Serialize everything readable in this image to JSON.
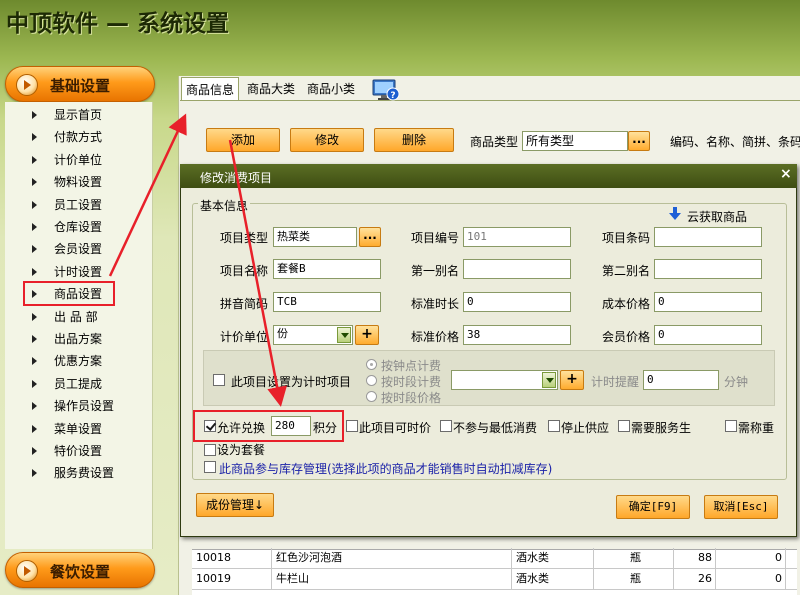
{
  "app": {
    "title": "中顶软件 — 系统设置"
  },
  "sidebar": {
    "section_top": "基础设置",
    "section_bottom": "餐饮设置",
    "items": [
      "显示首页",
      "付款方式",
      "计价单位",
      "物料设置",
      "员工设置",
      "仓库设置",
      "会员设置",
      "计时设置",
      "商品设置",
      "出 品 部",
      "出品方案",
      "优惠方案",
      "员工提成",
      "操作员设置",
      "菜单设置",
      "特价设置",
      "服务费设置"
    ]
  },
  "tabs": [
    "商品信息",
    "商品大类",
    "商品小类"
  ],
  "toolbar": {
    "add": "添加",
    "edit": "修改",
    "delete": "删除",
    "type_label": "商品类型",
    "type_value": "所有类型",
    "dots": "...",
    "search_hint": "编码、名称、简拼、条码"
  },
  "grid": {
    "rows": [
      [
        "10018",
        "红色沙河泡酒",
        "酒水类",
        "瓶",
        "88",
        "0"
      ],
      [
        "10019",
        "牛栏山",
        "酒水类",
        "瓶",
        "26",
        "0"
      ]
    ]
  },
  "dialog": {
    "title": "修改消费项目",
    "close": "×",
    "group": "基本信息",
    "cloud": "云获取商品",
    "fields": {
      "item_type_label": "项目类型",
      "item_type": "热菜类",
      "item_no_label": "项目编号",
      "item_no": "101",
      "barcode_label": "项目条码",
      "barcode": "",
      "name_label": "项目名称",
      "name": "套餐B",
      "alias1_label": "第一别名",
      "alias1": "",
      "alias2_label": "第二别名",
      "alias2": "",
      "pinyin_label": "拼音简码",
      "pinyin": "TCB",
      "std_time_label": "标准时长",
      "std_time": "0",
      "cost_label": "成本价格",
      "cost": "0",
      "unit_label": "计价单位",
      "unit": "份",
      "std_price_label": "标准价格",
      "std_price": "38",
      "member_price_label": "会员价格",
      "member_price": "0"
    },
    "timed": {
      "checkbox_label": "此项目设置为计时项目",
      "opt1": "按钟点计费",
      "opt2": "按时段计费",
      "opt3": "按时段价格",
      "reminder_label": "计时提醒",
      "reminder": "0",
      "minutes": "分钟"
    },
    "options": {
      "redeem_label": "允许兑换",
      "redeem_points": "280",
      "points_unit": "积分",
      "timed_price": "此项目可时价",
      "no_min": "不参与最低消费",
      "stop_supply": "停止供应",
      "need_service": "需要服务生",
      "need_weigh": "需称重",
      "set_meal": "设为套餐",
      "inventory": "此商品参与库存管理(选择此项的商品才能销售时自动扣减库存)"
    },
    "buttons": {
      "components": "成份管理↓",
      "ok": "确定[F9]",
      "cancel": "取消[Esc]"
    }
  },
  "colors": {
    "accent": "#ff9a1a",
    "highlight": "#e8202a",
    "dialog_title": "#3e4d12",
    "link_blue": "#1b22a8"
  }
}
